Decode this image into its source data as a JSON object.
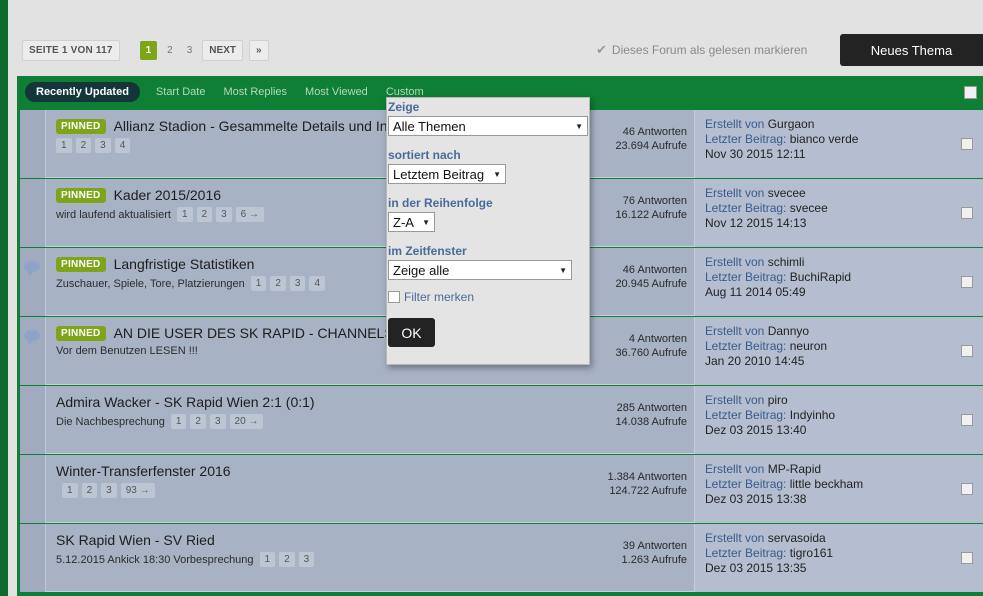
{
  "pagination": {
    "info": "SEITE 1 VON 117",
    "pages": [
      "1",
      "2",
      "3"
    ],
    "next_label": "NEXT",
    "last_label": "»"
  },
  "mark_read": {
    "label": "Dieses Forum als gelesen markieren"
  },
  "new_topic": {
    "label": "Neues Thema"
  },
  "tabs": {
    "active": "Recently Updated",
    "items": [
      "Start Date",
      "Most Replies",
      "Most Viewed",
      "Custom"
    ]
  },
  "filter_panel": {
    "show_label": "Zeige",
    "show_value": "Alle Themen",
    "sort_label": "sortiert nach",
    "sort_value": "Letztem Beitrag",
    "order_label": "in der Reihenfolge",
    "order_value": "Z-A",
    "time_label": "im Zeitfenster",
    "time_value": "Zeige alle",
    "remember_label": "Filter merken",
    "ok_label": "OK"
  },
  "labels": {
    "pinned": "PINNED",
    "created_by": "Erstellt von",
    "last_post": "Letzter Beitrag:"
  },
  "topics": [
    {
      "title": "Allianz Stadion - Gesammelte Details und Infos",
      "desc": "",
      "pages": [
        "1",
        "2",
        "3",
        "4"
      ],
      "replies": "46 Antworten",
      "views": "23.694 Aufrufe",
      "creator": "Gurgaon",
      "last_user": "bianco verde",
      "date": "Nov 30 2015 12:11"
    },
    {
      "title": "Kader 2015/2016",
      "desc": "wird laufend aktualisiert",
      "pages": [
        "1",
        "2",
        "3",
        "6 →"
      ],
      "replies": "76 Antworten",
      "views": "16.122 Aufrufe",
      "creator": "svecee",
      "last_user": "svecee",
      "date": "Nov 12 2015 14:13"
    },
    {
      "title": "Langfristige Statistiken",
      "desc": "Zuschauer, Spiele, Tore, Platzierungen",
      "pages": [
        "1",
        "2",
        "3",
        "4"
      ],
      "replies": "46 Antworten",
      "views": "20.945 Aufrufe",
      "creator": "schimli",
      "last_user": "BuchiRapid",
      "date": "Aug 11 2014 05:49"
    },
    {
      "title": "AN DIE USER DES SK RAPID - CHANNELS",
      "desc": "Vor dem Benutzen LESEN !!!",
      "pages": [],
      "replies": "4 Antworten",
      "views": "36.760 Aufrufe",
      "creator": "Dannyo",
      "last_user": "neuron",
      "date": "Jan 20 2010 14:45"
    },
    {
      "title": "Admira Wacker - SK Rapid Wien 2:1 (0:1)",
      "desc": "Die Nachbesprechung",
      "pages": [
        "1",
        "2",
        "3",
        "20 →"
      ],
      "replies": "285 Antworten",
      "views": "14.038 Aufrufe",
      "creator": "piro",
      "last_user": "Indyinho",
      "date": "Dez 03 2015 13:40"
    },
    {
      "title": "Winter-Transferfenster 2016",
      "desc": "",
      "pages": [
        "1",
        "2",
        "3",
        "93 →"
      ],
      "replies": "1.384 Antworten",
      "views": "124.722 Aufrufe",
      "creator": "MP-Rapid",
      "last_user": "little beckham",
      "date": "Dez 03 2015 13:38"
    },
    {
      "title": "SK Rapid Wien - SV Ried",
      "desc": "5.12.2015 Ankick 18:30 Vorbesprechung",
      "pages": [
        "1",
        "2",
        "3"
      ],
      "replies": "39 Antworten",
      "views": "1.263 Aufrufe",
      "creator": "servasoida",
      "last_user": "tigro161",
      "date": "Dez 03 2015 13:35"
    }
  ]
}
